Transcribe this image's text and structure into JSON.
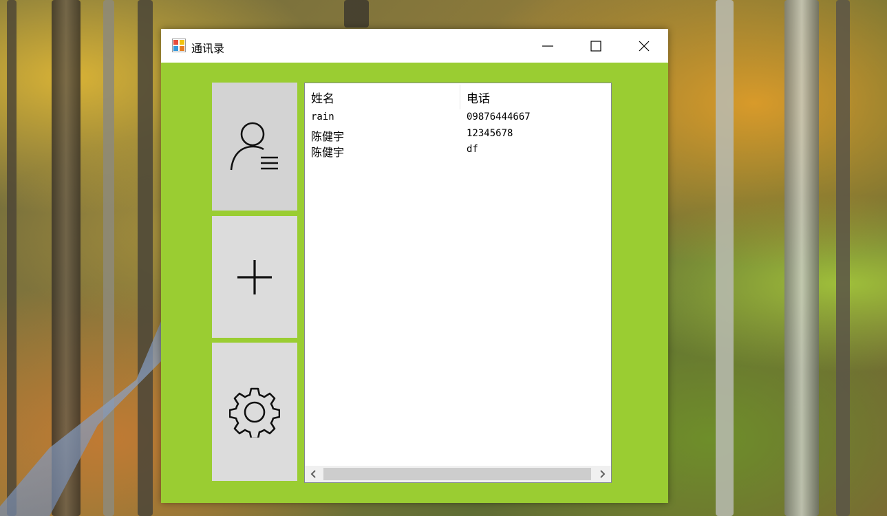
{
  "window": {
    "title": "通讯录",
    "icon": "app-window-icon",
    "controls": {
      "minimize": "minimize-icon",
      "maximize": "maximize-icon",
      "close": "close-icon"
    }
  },
  "colors": {
    "window_bg": "#9acd32",
    "titlebar_bg": "#ffffff",
    "side_button_bg": "#dcdcdc"
  },
  "sidebar": {
    "buttons": [
      {
        "id": "contacts",
        "icon": "contact-list-icon"
      },
      {
        "id": "add",
        "icon": "plus-icon"
      },
      {
        "id": "settings",
        "icon": "gear-icon"
      }
    ]
  },
  "list": {
    "columns": [
      "姓名",
      "电话"
    ],
    "rows": [
      {
        "name": "rain",
        "phone": "09876444667"
      },
      {
        "name": "陈健宇",
        "phone": "12345678"
      },
      {
        "name": "陈健宇",
        "phone": "df"
      }
    ]
  },
  "scrollbar": {
    "left_icon": "chevron-left-icon",
    "right_icon": "chevron-right-icon"
  }
}
